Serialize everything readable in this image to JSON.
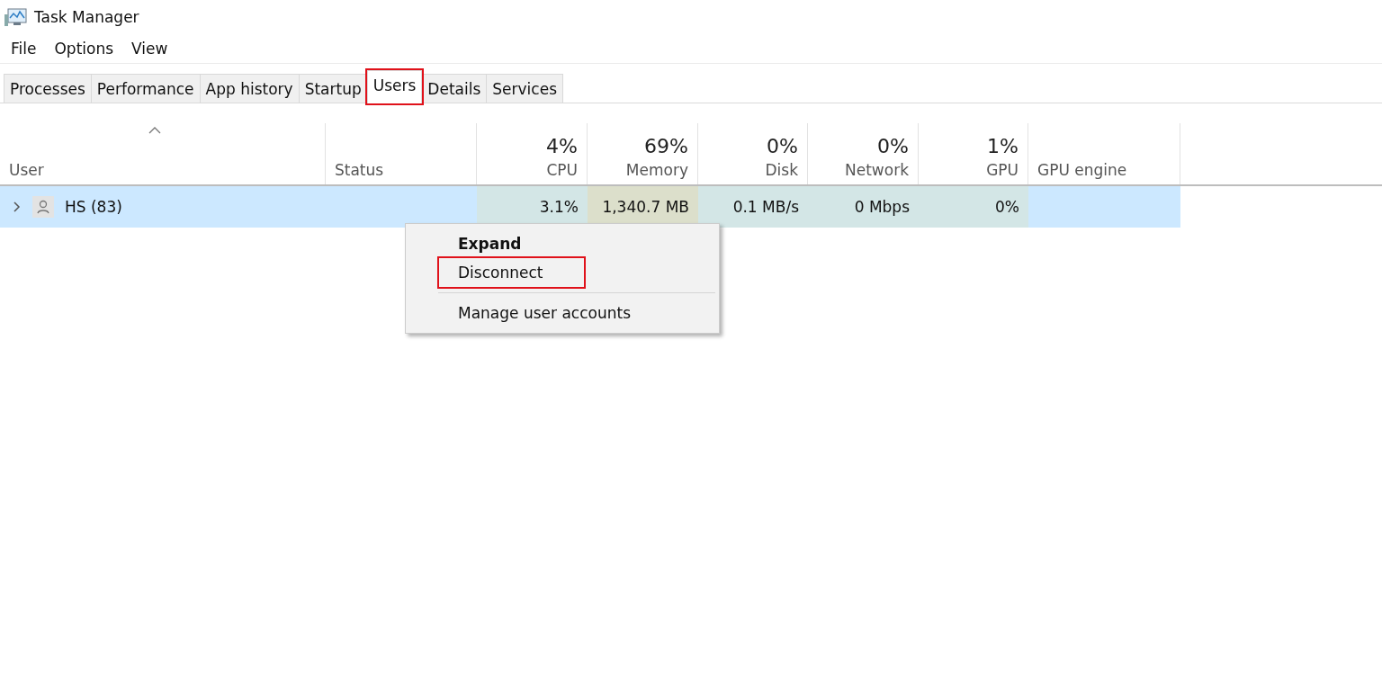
{
  "window": {
    "title": "Task Manager"
  },
  "menu": [
    "File",
    "Options",
    "View"
  ],
  "tabs": [
    {
      "label": "Processes",
      "selected": false,
      "highlighted": false
    },
    {
      "label": "Performance",
      "selected": false,
      "highlighted": false
    },
    {
      "label": "App history",
      "selected": false,
      "highlighted": false
    },
    {
      "label": "Startup",
      "selected": false,
      "highlighted": false
    },
    {
      "label": "Users",
      "selected": true,
      "highlighted": true
    },
    {
      "label": "Details",
      "selected": false,
      "highlighted": false
    },
    {
      "label": "Services",
      "selected": false,
      "highlighted": false
    }
  ],
  "table": {
    "columns": [
      {
        "label": "User",
        "sorted": true
      },
      {
        "label": "Status",
        "sorted": false
      },
      {
        "label": "CPU",
        "total": "4%",
        "sorted": false
      },
      {
        "label": "Memory",
        "total": "69%",
        "sorted": false
      },
      {
        "label": "Disk",
        "total": "0%",
        "sorted": false
      },
      {
        "label": "Network",
        "total": "0%",
        "sorted": false
      },
      {
        "label": "GPU",
        "total": "1%",
        "sorted": false
      },
      {
        "label": "GPU engine",
        "sorted": false
      }
    ],
    "rows": [
      {
        "expanded": false,
        "selected": true,
        "cells": [
          {
            "text": "HS (83)",
            "color": "#cce8ff"
          },
          {
            "text": "",
            "color": "#cce8ff"
          },
          {
            "text": "3.1%",
            "color": "#d3e6e6"
          },
          {
            "text": "1,340.7 MB",
            "color": "#dcdfcb"
          },
          {
            "text": "0.1 MB/s",
            "color": "#d3e6e6"
          },
          {
            "text": "0 Mbps",
            "color": "#d3e6e6"
          },
          {
            "text": "0%",
            "color": "#d3e6e6"
          },
          {
            "text": "",
            "color": "#cce8ff"
          }
        ]
      }
    ]
  },
  "context_menu": {
    "items": [
      {
        "label": "Expand",
        "bold": true,
        "highlighted": false
      },
      {
        "label": "Disconnect",
        "bold": false,
        "highlighted": true
      },
      {
        "label": "Manage user accounts",
        "bold": false,
        "highlighted": false
      }
    ]
  }
}
